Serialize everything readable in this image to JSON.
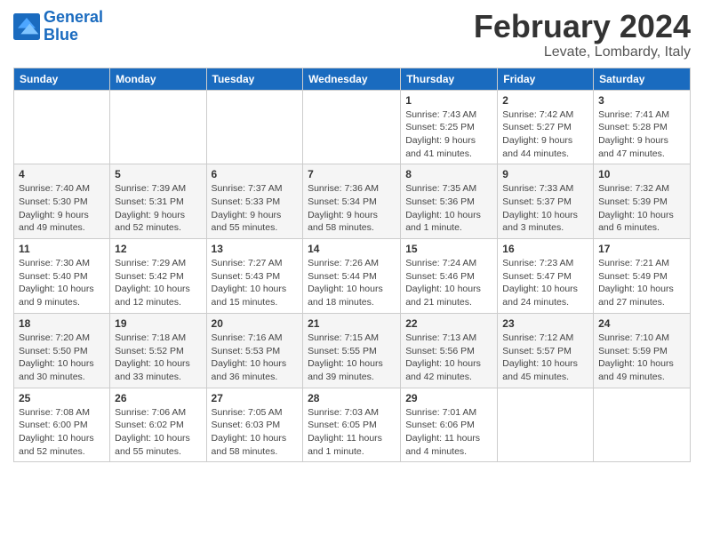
{
  "logo": {
    "line1": "General",
    "line2": "Blue"
  },
  "title": "February 2024",
  "subtitle": "Levate, Lombardy, Italy",
  "days_header": [
    "Sunday",
    "Monday",
    "Tuesday",
    "Wednesday",
    "Thursday",
    "Friday",
    "Saturday"
  ],
  "weeks": [
    [
      {
        "num": "",
        "info": ""
      },
      {
        "num": "",
        "info": ""
      },
      {
        "num": "",
        "info": ""
      },
      {
        "num": "",
        "info": ""
      },
      {
        "num": "1",
        "info": "Sunrise: 7:43 AM\nSunset: 5:25 PM\nDaylight: 9 hours\nand 41 minutes."
      },
      {
        "num": "2",
        "info": "Sunrise: 7:42 AM\nSunset: 5:27 PM\nDaylight: 9 hours\nand 44 minutes."
      },
      {
        "num": "3",
        "info": "Sunrise: 7:41 AM\nSunset: 5:28 PM\nDaylight: 9 hours\nand 47 minutes."
      }
    ],
    [
      {
        "num": "4",
        "info": "Sunrise: 7:40 AM\nSunset: 5:30 PM\nDaylight: 9 hours\nand 49 minutes."
      },
      {
        "num": "5",
        "info": "Sunrise: 7:39 AM\nSunset: 5:31 PM\nDaylight: 9 hours\nand 52 minutes."
      },
      {
        "num": "6",
        "info": "Sunrise: 7:37 AM\nSunset: 5:33 PM\nDaylight: 9 hours\nand 55 minutes."
      },
      {
        "num": "7",
        "info": "Sunrise: 7:36 AM\nSunset: 5:34 PM\nDaylight: 9 hours\nand 58 minutes."
      },
      {
        "num": "8",
        "info": "Sunrise: 7:35 AM\nSunset: 5:36 PM\nDaylight: 10 hours\nand 1 minute."
      },
      {
        "num": "9",
        "info": "Sunrise: 7:33 AM\nSunset: 5:37 PM\nDaylight: 10 hours\nand 3 minutes."
      },
      {
        "num": "10",
        "info": "Sunrise: 7:32 AM\nSunset: 5:39 PM\nDaylight: 10 hours\nand 6 minutes."
      }
    ],
    [
      {
        "num": "11",
        "info": "Sunrise: 7:30 AM\nSunset: 5:40 PM\nDaylight: 10 hours\nand 9 minutes."
      },
      {
        "num": "12",
        "info": "Sunrise: 7:29 AM\nSunset: 5:42 PM\nDaylight: 10 hours\nand 12 minutes."
      },
      {
        "num": "13",
        "info": "Sunrise: 7:27 AM\nSunset: 5:43 PM\nDaylight: 10 hours\nand 15 minutes."
      },
      {
        "num": "14",
        "info": "Sunrise: 7:26 AM\nSunset: 5:44 PM\nDaylight: 10 hours\nand 18 minutes."
      },
      {
        "num": "15",
        "info": "Sunrise: 7:24 AM\nSunset: 5:46 PM\nDaylight: 10 hours\nand 21 minutes."
      },
      {
        "num": "16",
        "info": "Sunrise: 7:23 AM\nSunset: 5:47 PM\nDaylight: 10 hours\nand 24 minutes."
      },
      {
        "num": "17",
        "info": "Sunrise: 7:21 AM\nSunset: 5:49 PM\nDaylight: 10 hours\nand 27 minutes."
      }
    ],
    [
      {
        "num": "18",
        "info": "Sunrise: 7:20 AM\nSunset: 5:50 PM\nDaylight: 10 hours\nand 30 minutes."
      },
      {
        "num": "19",
        "info": "Sunrise: 7:18 AM\nSunset: 5:52 PM\nDaylight: 10 hours\nand 33 minutes."
      },
      {
        "num": "20",
        "info": "Sunrise: 7:16 AM\nSunset: 5:53 PM\nDaylight: 10 hours\nand 36 minutes."
      },
      {
        "num": "21",
        "info": "Sunrise: 7:15 AM\nSunset: 5:55 PM\nDaylight: 10 hours\nand 39 minutes."
      },
      {
        "num": "22",
        "info": "Sunrise: 7:13 AM\nSunset: 5:56 PM\nDaylight: 10 hours\nand 42 minutes."
      },
      {
        "num": "23",
        "info": "Sunrise: 7:12 AM\nSunset: 5:57 PM\nDaylight: 10 hours\nand 45 minutes."
      },
      {
        "num": "24",
        "info": "Sunrise: 7:10 AM\nSunset: 5:59 PM\nDaylight: 10 hours\nand 49 minutes."
      }
    ],
    [
      {
        "num": "25",
        "info": "Sunrise: 7:08 AM\nSunset: 6:00 PM\nDaylight: 10 hours\nand 52 minutes."
      },
      {
        "num": "26",
        "info": "Sunrise: 7:06 AM\nSunset: 6:02 PM\nDaylight: 10 hours\nand 55 minutes."
      },
      {
        "num": "27",
        "info": "Sunrise: 7:05 AM\nSunset: 6:03 PM\nDaylight: 10 hours\nand 58 minutes."
      },
      {
        "num": "28",
        "info": "Sunrise: 7:03 AM\nSunset: 6:05 PM\nDaylight: 11 hours\nand 1 minute."
      },
      {
        "num": "29",
        "info": "Sunrise: 7:01 AM\nSunset: 6:06 PM\nDaylight: 11 hours\nand 4 minutes."
      },
      {
        "num": "",
        "info": ""
      },
      {
        "num": "",
        "info": ""
      }
    ]
  ]
}
